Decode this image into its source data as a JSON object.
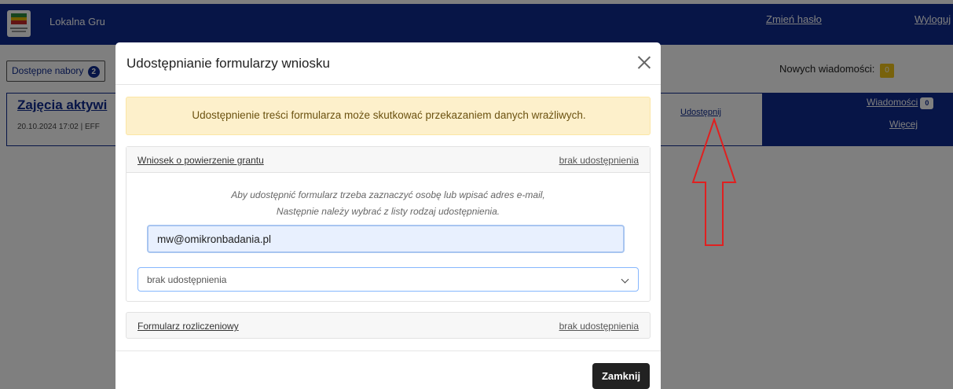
{
  "app": {
    "brand": "Lokalna Gru",
    "change_password": "Zmień hasło",
    "logout": "Wyloguj"
  },
  "toolbar": {
    "nabory_label": "Dostępne nabory",
    "nabory_count": "2",
    "new_messages_label": "Nowych wiadomości:",
    "new_messages_count": "0"
  },
  "row": {
    "title": "Zajęcia aktywi",
    "meta": "20.10.2024 17:02 | EFF",
    "share_link": "Udostępnij",
    "messages_label": "Wiadomości",
    "messages_count": "0",
    "more_label": "Więcej"
  },
  "modal": {
    "title": "Udostępnianie formularzy wniosku",
    "warning": "Udostępnienie treści formularza może skutkować przekazaniem danych wrażliwych.",
    "forms": [
      {
        "name": "Wniosek o powierzenie grantu",
        "status": "brak udostępnienia",
        "hint_line1": "Aby udostępnić formularz trzeba zaznaczyć osobę lub wpisać adres e-mail,",
        "hint_line2": "Następnie należy wybrać z listy rodzaj udostępnienia.",
        "email_value": "mw@omikronbadania.pl",
        "share_type_selected": "brak udostępnienia"
      },
      {
        "name": "Formularz rozliczeniowy",
        "status": "brak udostępnienia"
      }
    ],
    "close_button": "Zamknij"
  },
  "colors": {
    "nav_blue": "#0f2a8e",
    "warning_bg": "#fdf0cb",
    "annotation_red": "#e02020",
    "button_dark": "#222222"
  }
}
